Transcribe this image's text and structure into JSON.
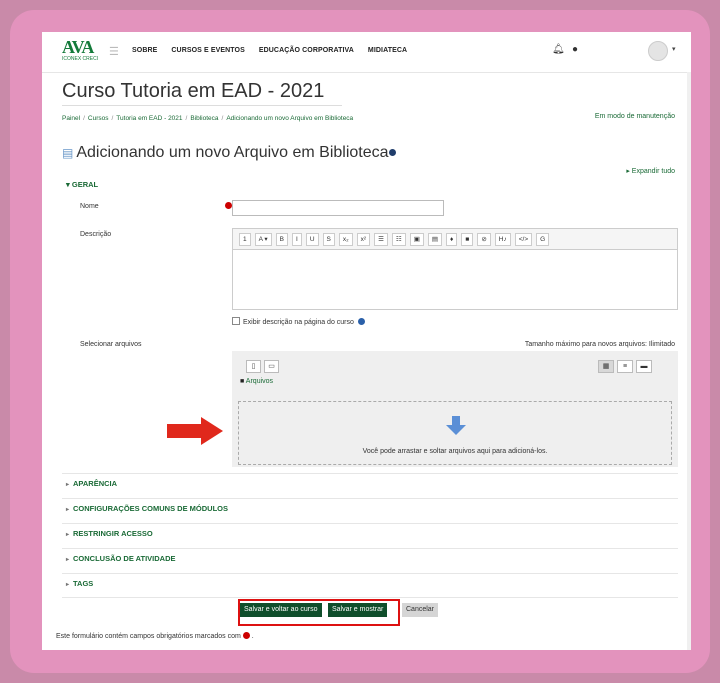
{
  "colors": {
    "brand": "#137a3a",
    "link": "#1a6a36",
    "primary_button": "#0f4e2b",
    "required": "#cc0000",
    "highlight": "#dd1111",
    "frame": "#e393bd"
  },
  "navbar": {
    "logo_text": "AVA",
    "logo_sub": "ICONEX CRECI",
    "links": [
      "SOBRE",
      "CURSOS E EVENTOS",
      "EDUCAÇÃO CORPORATIVA",
      "MIDIATECA"
    ],
    "icons": [
      "menu-icon",
      "bell-icon",
      "chat-icon",
      "user-avatar",
      "chevron-down-icon"
    ]
  },
  "course_title": "Curso Tutoria em EAD - 2021",
  "breadcrumb": [
    "Painel",
    "Cursos",
    "Tutoria em EAD - 2021",
    "Biblioteca",
    "Adicionando um novo Arquivo em Biblioteca"
  ],
  "maintenance": "Em modo de manutenção",
  "page_heading": "Adicionando um novo Arquivo em Biblioteca",
  "expand_all": "Expandir tudo",
  "geral": {
    "title": "GERAL",
    "name_label": "Nome",
    "name_value": "",
    "description_label": "Descrição",
    "editor_buttons": [
      "1",
      "A ▾",
      "B",
      "I",
      "U",
      "S",
      "x₂",
      "x²",
      "☰",
      "☷",
      "▣",
      "▤",
      "♦",
      "■",
      "⊘",
      "H♪",
      "</>",
      "G"
    ],
    "show_description": "Exibir descrição na página do curso"
  },
  "files": {
    "label": "Selecionar arquivos",
    "max_size": "Tamanho máximo para novos arquivos: Ilimitado",
    "folder_label": "Arquivos",
    "drop_text": "Você pode arrastar e soltar arquivos aqui para adicioná-los."
  },
  "sections": [
    "APARÊNCIA",
    "CONFIGURAÇÕES COMUNS DE MÓDULOS",
    "RESTRINGIR ACESSO",
    "CONCLUSÃO DE ATIVIDADE",
    "TAGS"
  ],
  "buttons": {
    "save_return": "Salvar e voltar ao curso",
    "save_show": "Salvar e mostrar",
    "cancel": "Cancelar"
  },
  "footnote": "Este formulário contém campos obrigatórios marcados com",
  "footnote_end": "."
}
